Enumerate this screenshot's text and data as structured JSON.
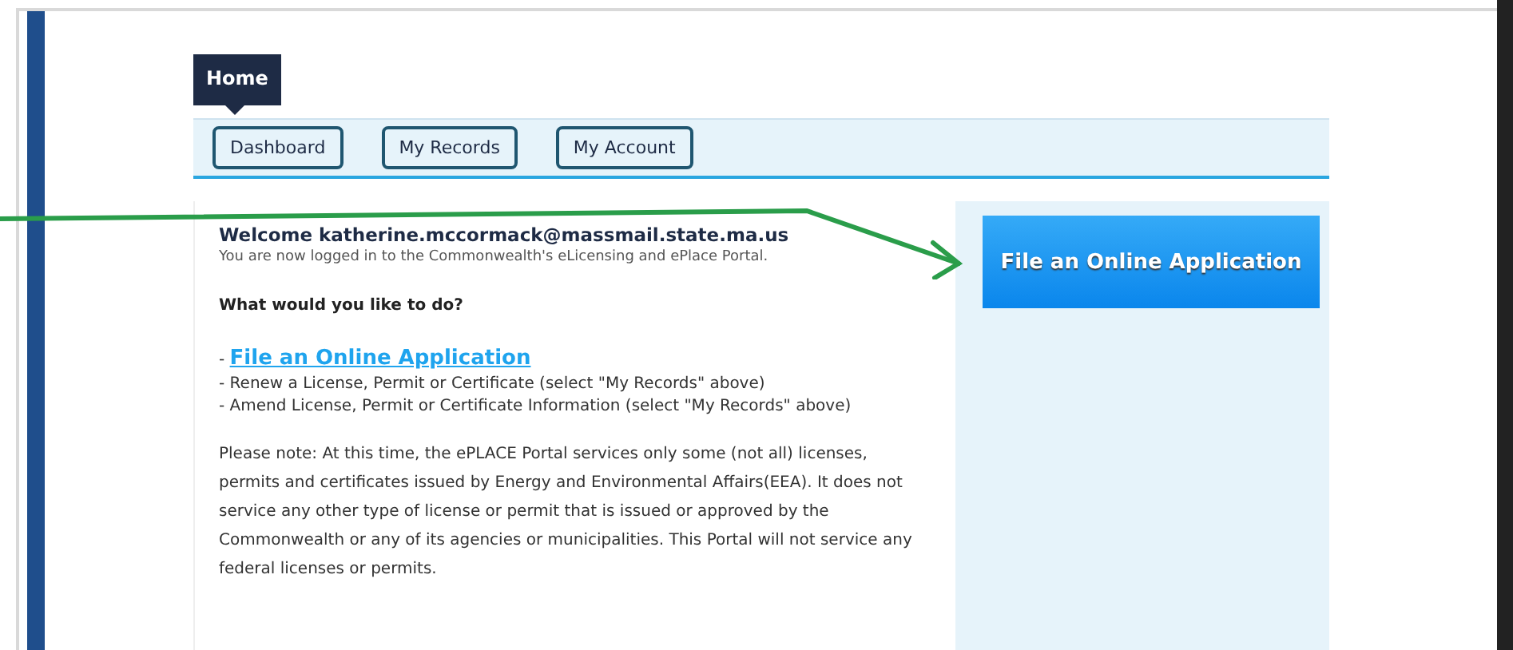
{
  "home_tab": {
    "label": "Home"
  },
  "nav_buttons": [
    {
      "label": "Dashboard"
    },
    {
      "label": "My Records"
    },
    {
      "label": "My Account"
    }
  ],
  "welcome": {
    "title": "Welcome katherine.mccormack@massmail.state.ma.us",
    "subtitle": "You are now logged in to the Commonwealth's eLicensing and ePlace Portal."
  },
  "question": "What would you like to do?",
  "options": [
    {
      "kind": "link",
      "prefix": "- ",
      "text": "File an Online Application"
    },
    {
      "kind": "text",
      "prefix": "- ",
      "text": "Renew a License, Permit or Certificate (select \"My Records\" above)"
    },
    {
      "kind": "text",
      "prefix": "- ",
      "text": "Amend License, Permit or Certificate Information (select \"My Records\" above)"
    }
  ],
  "note": "Please note: At this time, the ePLACE Portal services only some (not all) licenses, permits and certificates issued by Energy and Environmental Affairs(EEA). It does not service any other type of license or permit that is issued or approved by the Commonwealth or any of its agencies or municipalities. This Portal will not service any federal licenses or permits.",
  "side_button": {
    "label": "File an Online Application"
  }
}
